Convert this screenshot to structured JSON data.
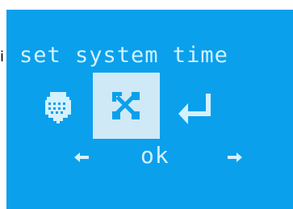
{
  "app": {
    "title": "set system time"
  },
  "screen": {
    "stray_char": "i",
    "colors": {
      "background": "#0aa0ec",
      "text": "#d3f1ff",
      "selection": "#cfe9f6"
    }
  },
  "menu": {
    "items": [
      {
        "icon": "calendar-icon"
      },
      {
        "icon": "tools-icon",
        "selected": true
      },
      {
        "icon": "enter-icon"
      }
    ]
  },
  "nav": {
    "left_icon": "arrow-left-icon",
    "ok_label": "ok",
    "right_icon": "arrow-right-icon"
  }
}
